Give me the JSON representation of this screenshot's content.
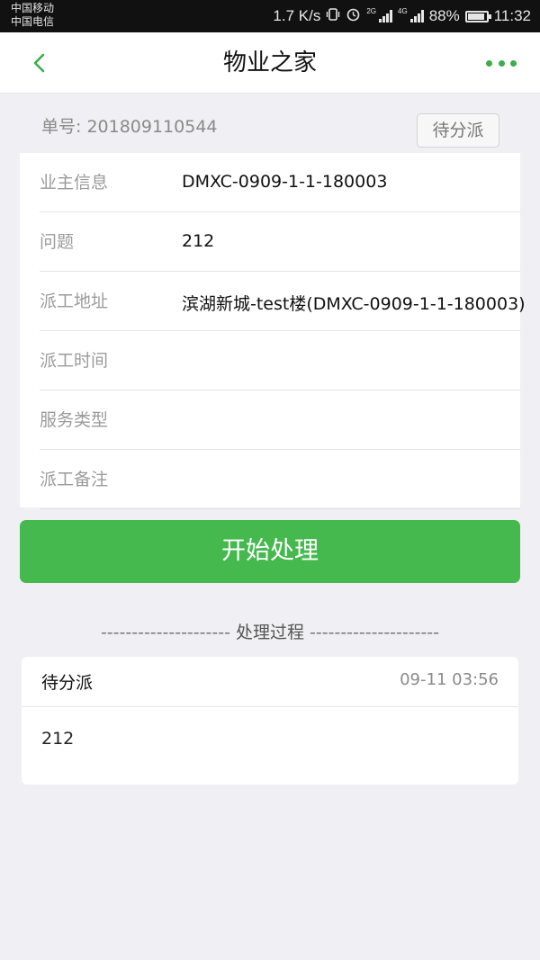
{
  "status_bar": {
    "carrier_1": "中国移动",
    "carrier_2": "中国电信",
    "net_speed": "1.7 K/s",
    "net_1": "2G",
    "net_2": "4G",
    "battery": "88%",
    "time": "11:32"
  },
  "header": {
    "title": "物业之家"
  },
  "order": {
    "number_text": "单号: 201809110544",
    "status": "待分派"
  },
  "info_rows": [
    {
      "label": "业主信息",
      "value": "DMXC-0909-1-1-180003"
    },
    {
      "label": "问题",
      "value": "212"
    },
    {
      "label": "派工地址",
      "value": "滨湖新城-test楼(DMXC-0909-1-1-180003)"
    },
    {
      "label": "派工时间",
      "value": ""
    },
    {
      "label": "服务类型",
      "value": ""
    },
    {
      "label": "派工备注",
      "value": ""
    }
  ],
  "actions": {
    "start_label": "开始处理"
  },
  "process": {
    "section_title": "处理过程",
    "dashes_left": "---------------------",
    "dashes_right": "---------------------",
    "entries": [
      {
        "status": "待分派",
        "time": "09-11 03:56",
        "content": "212"
      }
    ]
  },
  "colors": {
    "accent": "#45b84e",
    "background": "#efeff4"
  }
}
